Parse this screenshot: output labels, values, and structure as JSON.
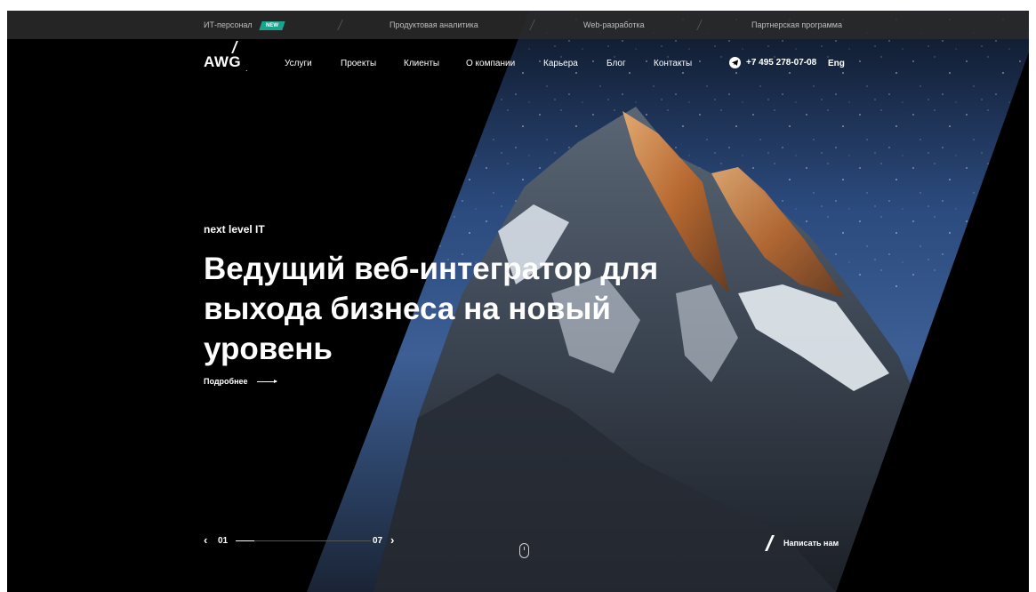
{
  "topbar": {
    "items": [
      "ИТ-персонал",
      "Продуктовая аналитика",
      "Web-разработка",
      "Партнерская программа"
    ],
    "badge": "NEW",
    "badge_color": "#19a58d"
  },
  "header": {
    "logo": "AWG",
    "nav": [
      "Услуги",
      "Проекты",
      "Клиенты",
      "О компании",
      "Карьера",
      "Блог",
      "Контакты"
    ],
    "phone": "+7 495 278-07-08",
    "phone_icon": "telegram-icon",
    "lang": "Eng"
  },
  "hero": {
    "tagline": "next level IT",
    "headline": "Ведущий веб-интегратор для выхода бизнеса на новый уровень",
    "more": "Подробнее"
  },
  "slider": {
    "current": "01",
    "total": "07",
    "progress": 0.14
  },
  "contact": {
    "label": "Написать нам"
  },
  "colors": {
    "background": "#000000",
    "accent": "#19a58d"
  }
}
